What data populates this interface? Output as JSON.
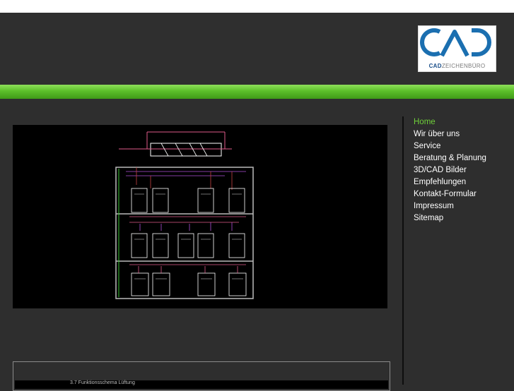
{
  "brand": {
    "logo_letters": "CAD",
    "name_bold": "CAD",
    "name_rest": "ZEICHENBÜRO",
    "colors": {
      "blue": "#1b6fb0",
      "dark_blue": "#1b4f8a"
    }
  },
  "colors": {
    "background": "#2e2e2e",
    "accent_green": "#5cbf2a",
    "active_link": "#6fcf3a",
    "link": "#ffffff"
  },
  "nav": {
    "items": [
      {
        "label": "Home",
        "active": true
      },
      {
        "label": "Wir über uns"
      },
      {
        "label": "Service"
      },
      {
        "label": "Beratung & Planung"
      },
      {
        "label": "3D/CAD Bilder"
      },
      {
        "label": "Empfehlungen"
      },
      {
        "label": "Kontakt-Formular"
      },
      {
        "label": "Impressum"
      },
      {
        "label": "Sitemap"
      }
    ]
  },
  "hero": {
    "image": "cad-wiring-schematic"
  },
  "panel": {
    "caption": "3.7 Funktionsschema Lüftung"
  }
}
